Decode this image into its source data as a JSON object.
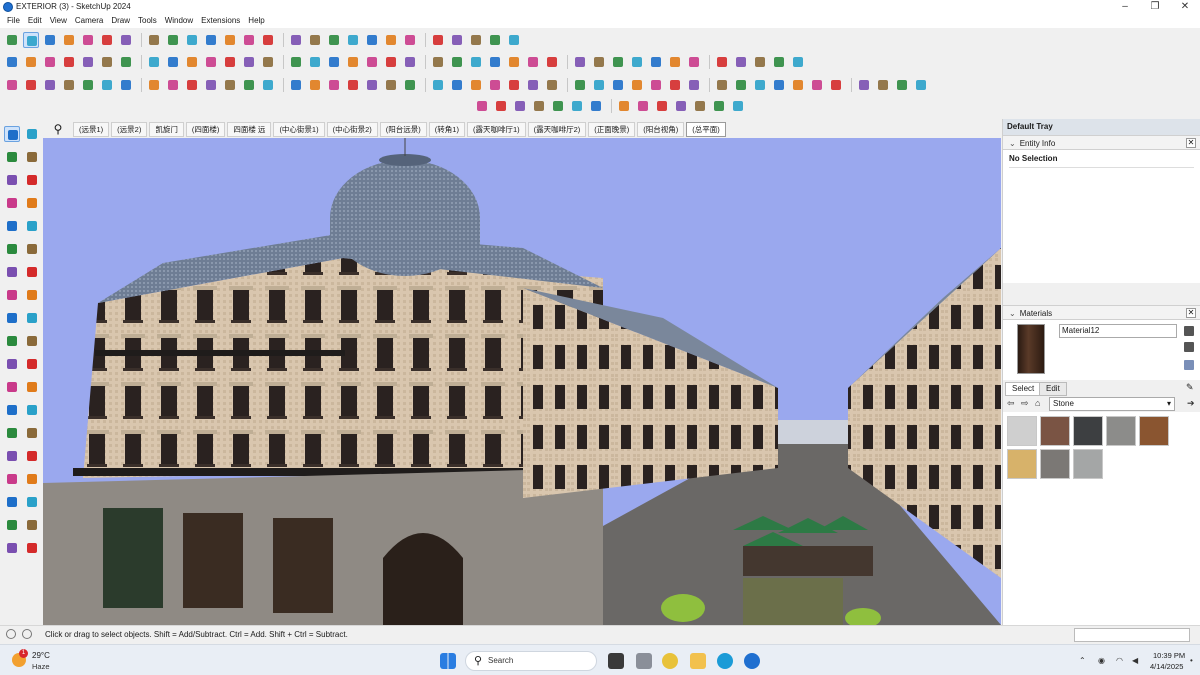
{
  "window": {
    "title": "EXTERIOR (3) - SketchUp 2024"
  },
  "menu": [
    "File",
    "Edit",
    "View",
    "Camera",
    "Draw",
    "Tools",
    "Window",
    "Extensions",
    "Help"
  ],
  "scenes": {
    "tabs": [
      "(远景1)",
      "(远景2)",
      "凯旋门",
      "(四面楼)",
      "四面楼 远",
      "(中心街景1)",
      "(中心街景2)",
      "(阳台远景)",
      "(转角1)",
      "(露天咖啡厅1)",
      "(露天咖啡厅2)",
      "(正面晚景)",
      "(阳台视角)",
      "(总平面)"
    ],
    "active_index": 13
  },
  "tray": {
    "title": "Default Tray",
    "entity_info": {
      "header": "Entity Info",
      "selection": "No Selection"
    },
    "materials": {
      "header": "Materials",
      "current_name": "Material12",
      "tab_select": "Select",
      "tab_edit": "Edit",
      "library": "Stone",
      "swatches": [
        "#cfcfcf",
        "#7a5444",
        "#3d3f41",
        "#8c8c8a",
        "#8a5530",
        "#d7b26a",
        "#7b7875",
        "#a4a6a6"
      ]
    }
  },
  "status": {
    "text": "Click or drag to select objects. Shift = Add/Subtract. Ctrl = Add. Shift + Ctrl = Subtract."
  },
  "taskbar": {
    "weather": {
      "temp": "29°C",
      "condition": "Haze",
      "badge": "1"
    },
    "search_label": "Search",
    "time": "10:39 PM",
    "date": "4/14/2025"
  }
}
